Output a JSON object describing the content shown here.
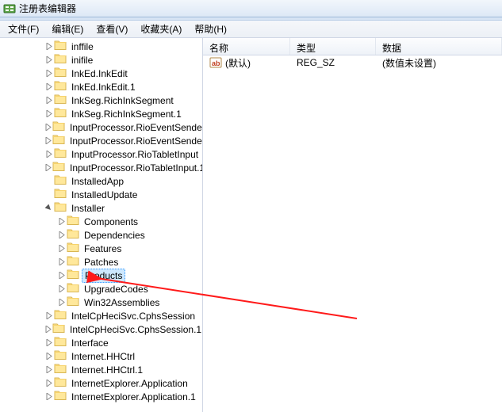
{
  "window": {
    "title": "注册表编辑器"
  },
  "menu": {
    "file": "文件(F)",
    "edit": "编辑(E)",
    "view": "查看(V)",
    "favorites": "收藏夹(A)",
    "help": "帮助(H)"
  },
  "tree": {
    "items": [
      {
        "label": "inffile",
        "level": 3,
        "expandable": true
      },
      {
        "label": "inifile",
        "level": 3,
        "expandable": true
      },
      {
        "label": "InkEd.InkEdit",
        "level": 3,
        "expandable": true
      },
      {
        "label": "InkEd.InkEdit.1",
        "level": 3,
        "expandable": true
      },
      {
        "label": "InkSeg.RichInkSegment",
        "level": 3,
        "expandable": true
      },
      {
        "label": "InkSeg.RichInkSegment.1",
        "level": 3,
        "expandable": true
      },
      {
        "label": "InputProcessor.RioEventSender",
        "level": 3,
        "expandable": true
      },
      {
        "label": "InputProcessor.RioEventSender.",
        "level": 3,
        "expandable": true
      },
      {
        "label": "InputProcessor.RioTabletInput",
        "level": 3,
        "expandable": true
      },
      {
        "label": "InputProcessor.RioTabletInput.1",
        "level": 3,
        "expandable": true
      },
      {
        "label": "InstalledApp",
        "level": 3,
        "expandable": false
      },
      {
        "label": "InstalledUpdate",
        "level": 3,
        "expandable": false
      },
      {
        "label": "Installer",
        "level": 3,
        "expandable": true,
        "expanded": true
      },
      {
        "label": "Components",
        "level": 4,
        "expandable": true
      },
      {
        "label": "Dependencies",
        "level": 4,
        "expandable": true
      },
      {
        "label": "Features",
        "level": 4,
        "expandable": true
      },
      {
        "label": "Patches",
        "level": 4,
        "expandable": true
      },
      {
        "label": "Products",
        "level": 4,
        "expandable": true,
        "selected": true
      },
      {
        "label": "UpgradeCodes",
        "level": 4,
        "expandable": true
      },
      {
        "label": "Win32Assemblies",
        "level": 4,
        "expandable": true
      },
      {
        "label": "IntelCpHeciSvc.CphsSession",
        "level": 3,
        "expandable": true
      },
      {
        "label": "IntelCpHeciSvc.CphsSession.1",
        "level": 3,
        "expandable": true
      },
      {
        "label": "Interface",
        "level": 3,
        "expandable": true
      },
      {
        "label": "Internet.HHCtrl",
        "level": 3,
        "expandable": true
      },
      {
        "label": "Internet.HHCtrl.1",
        "level": 3,
        "expandable": true
      },
      {
        "label": "InternetExplorer.Application",
        "level": 3,
        "expandable": true
      },
      {
        "label": "InternetExplorer.Application.1",
        "level": 3,
        "expandable": true
      }
    ]
  },
  "list": {
    "cols": {
      "name": "名称",
      "type": "类型",
      "data": "数据"
    },
    "row0": {
      "name": "(默认)",
      "type": "REG_SZ",
      "data": "(数值未设置)"
    }
  }
}
